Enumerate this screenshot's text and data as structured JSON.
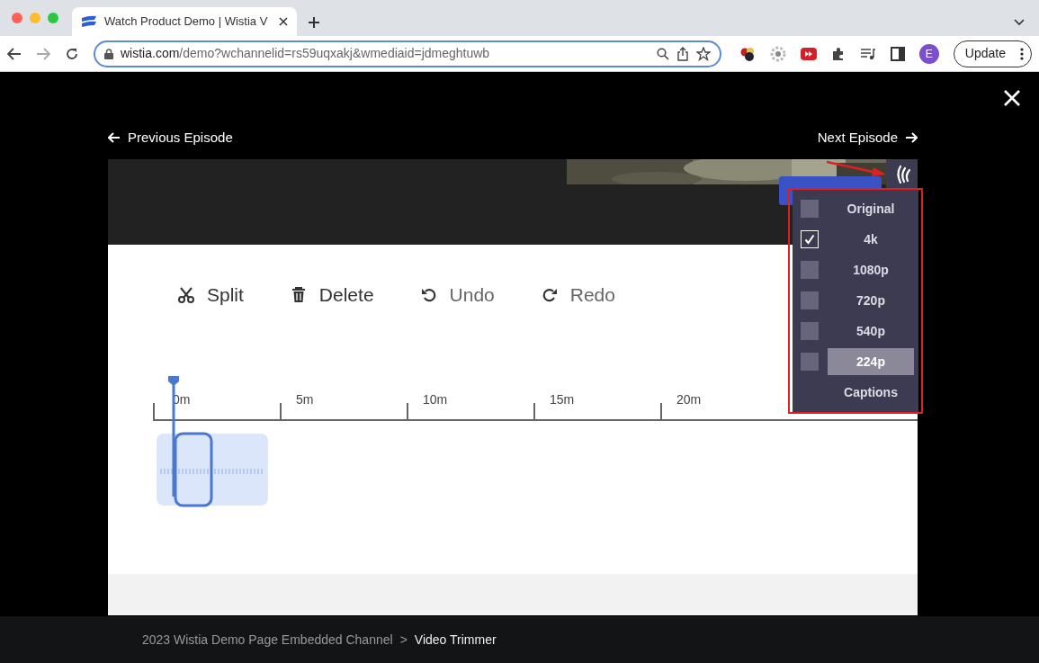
{
  "browser": {
    "tab_title": "Watch Product Demo | Wistia V",
    "url_host": "wistia.com",
    "url_path": "/demo?wchannelid=rs59uqxakj&wmediaid=jdmeghtuwb",
    "avatar": "E",
    "update_button": "Update"
  },
  "episode_nav": {
    "previous": "Previous Episode",
    "next": "Next Episode"
  },
  "editor_toolbar": [
    {
      "kind": "split",
      "label": "Split",
      "disabled": false
    },
    {
      "kind": "delete",
      "label": "Delete",
      "disabled": false
    },
    {
      "kind": "undo",
      "label": "Undo",
      "disabled": true
    },
    {
      "kind": "redo",
      "label": "Redo",
      "disabled": true
    }
  ],
  "timeline": {
    "ticks": [
      "0m",
      "5m",
      "10m",
      "15m",
      "20m"
    ]
  },
  "quality_menu": [
    {
      "kind": "quality",
      "label": "Original",
      "checked": false,
      "selected": false
    },
    {
      "kind": "quality",
      "label": "4k",
      "checked": true,
      "selected": false
    },
    {
      "kind": "quality",
      "label": "1080p",
      "checked": false,
      "selected": false
    },
    {
      "kind": "quality",
      "label": "720p",
      "checked": false,
      "selected": false
    },
    {
      "kind": "quality",
      "label": "540p",
      "checked": false,
      "selected": false
    },
    {
      "kind": "quality",
      "label": "224p",
      "checked": false,
      "selected": true
    },
    {
      "kind": "captions",
      "label": "Captions",
      "selected": false
    }
  ],
  "footer": {
    "breadcrumb": [
      "2023 Wistia Demo Page Embedded Channel",
      "Video Trimmer"
    ],
    "separator": ">"
  }
}
